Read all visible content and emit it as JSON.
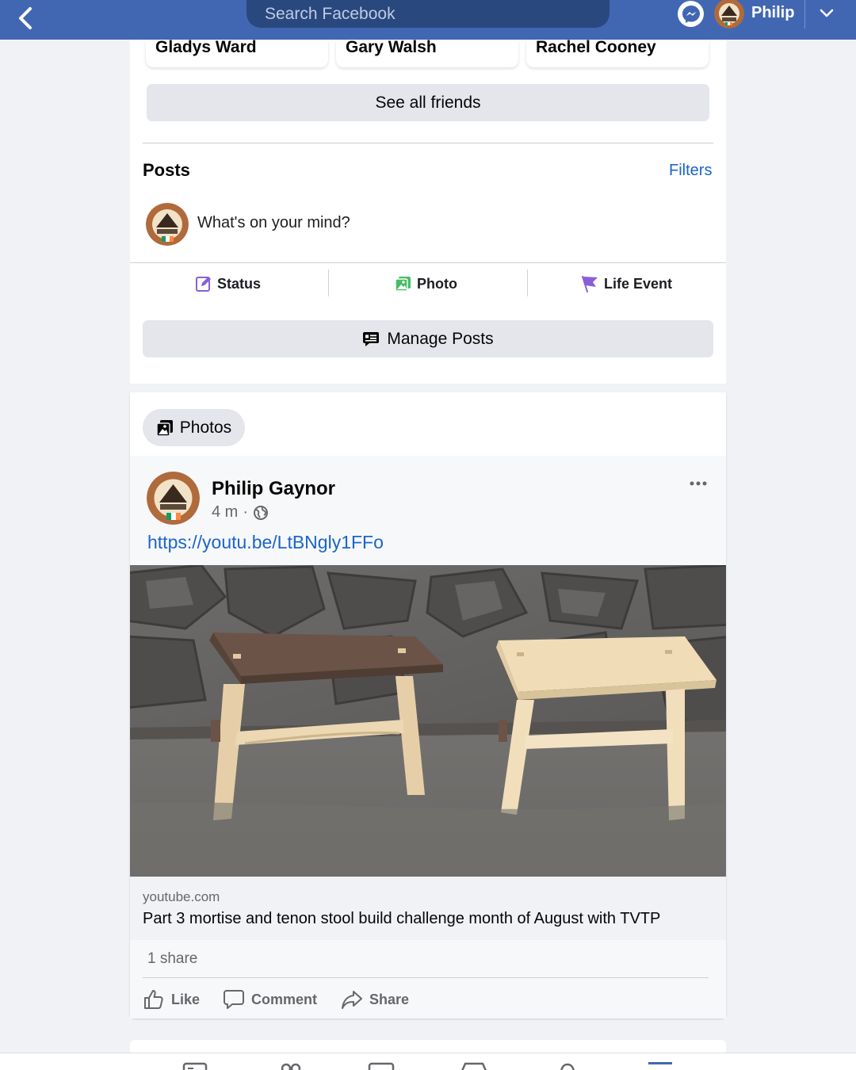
{
  "topbar": {
    "search_placeholder": "Search Facebook",
    "user_name": "Philip"
  },
  "friends": {
    "tiles": [
      {
        "name": "Gladys Ward"
      },
      {
        "name": "Gary Walsh"
      },
      {
        "name": "Rachel Cooney"
      }
    ],
    "see_all_label": "See all friends"
  },
  "posts_section": {
    "title": "Posts",
    "filters_label": "Filters",
    "composer_prompt": "What's on your mind?",
    "actions": {
      "status": "Status",
      "photo": "Photo",
      "life_event": "Life Event"
    },
    "manage_label": "Manage Posts"
  },
  "photos_chip_label": "Photos",
  "post": {
    "author": "Philip Gaynor",
    "time": "4 m",
    "separator": "·",
    "link_text": "https://youtu.be/LtBNgly1FFo",
    "preview": {
      "domain": "youtube.com",
      "title": "Part 3 mortise and tenon stool build challenge month of August with TVTP"
    },
    "shares": "1 share",
    "reactions": {
      "like": "Like",
      "comment": "Comment",
      "share": "Share"
    }
  },
  "colors": {
    "brand_blue": "#4267b2",
    "link_blue": "#1a65c9",
    "button_gray": "#e4e6eb"
  }
}
